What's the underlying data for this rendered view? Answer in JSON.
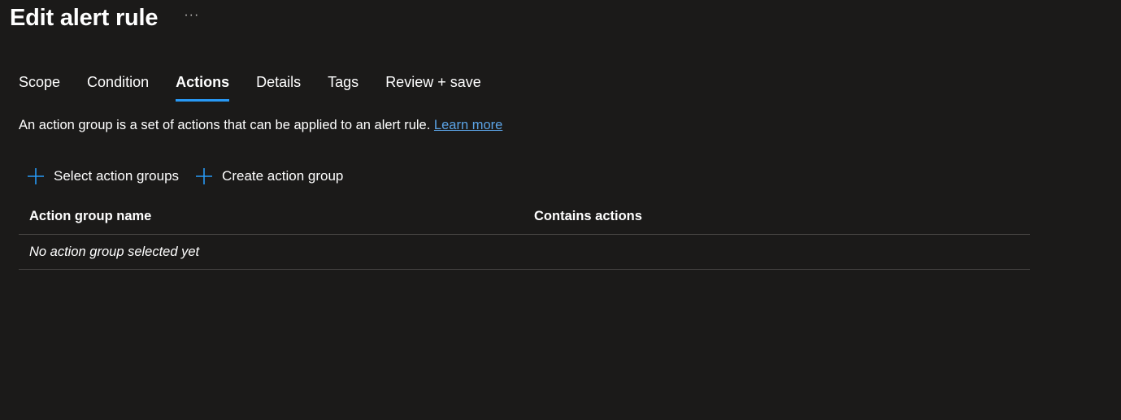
{
  "page": {
    "title": "Edit alert rule",
    "more_label": "···"
  },
  "tabs": [
    {
      "label": "Scope",
      "active": false
    },
    {
      "label": "Condition",
      "active": false
    },
    {
      "label": "Actions",
      "active": true
    },
    {
      "label": "Details",
      "active": false
    },
    {
      "label": "Tags",
      "active": false
    },
    {
      "label": "Review + save",
      "active": false
    }
  ],
  "description": {
    "text": "An action group is a set of actions that can be applied to an alert rule.",
    "link_label": "Learn more"
  },
  "toolbar": {
    "select_label": "Select action groups",
    "create_label": "Create action group",
    "icon": "plus-icon"
  },
  "table": {
    "columns": [
      "Action group name",
      "Contains actions"
    ],
    "empty_message": "No action group selected yet"
  },
  "colors": {
    "background": "#1b1a19",
    "accent": "#2899f5",
    "link": "#5ba3e5",
    "divider": "#484644"
  }
}
